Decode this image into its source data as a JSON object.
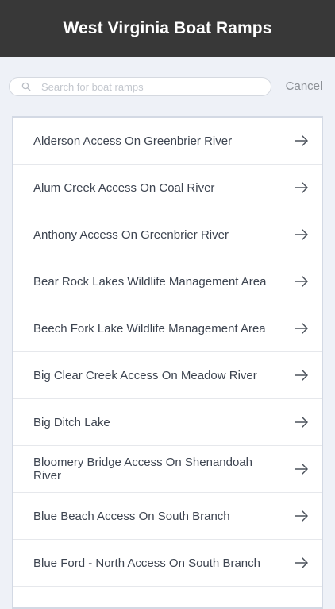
{
  "header": {
    "title": "West Virginia Boat Ramps"
  },
  "search": {
    "placeholder": "Search for boat ramps",
    "value": "",
    "cancel_label": "Cancel"
  },
  "icons": {
    "search": "search-icon",
    "row_arrow": "arrow-right-icon"
  },
  "colors": {
    "header_bg": "#383838",
    "page_bg": "#eef1f7",
    "text": "#3d4450"
  },
  "ramps": [
    "Alderson Access On Greenbrier River",
    "Alum Creek Access On Coal River",
    "Anthony Access On Greenbrier River",
    "Bear Rock Lakes Wildlife Management Area",
    "Beech Fork Lake Wildlife Management Area",
    "Big Clear Creek Access On Meadow River",
    "Big Ditch Lake",
    "Bloomery Bridge Access On Shenandoah River",
    "Blue Beach Access On South Branch",
    "Blue Ford - North Access On South Branch",
    ""
  ]
}
